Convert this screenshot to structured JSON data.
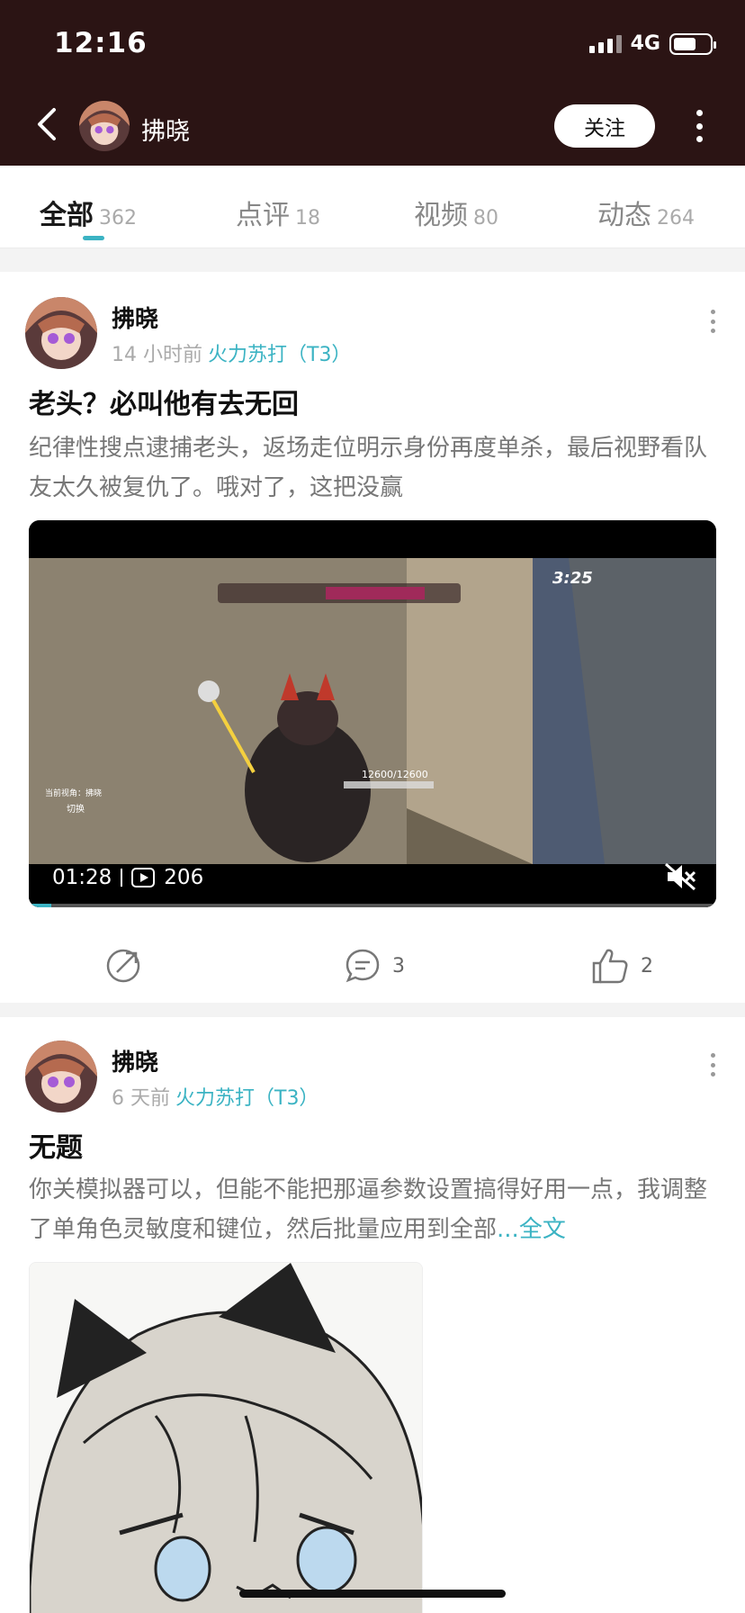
{
  "status_bar": {
    "time": "12:16",
    "network": "4G",
    "battery_level": 0.64
  },
  "nav": {
    "username": "拂晓",
    "follow_label": "关注"
  },
  "tabs": [
    {
      "label": "全部",
      "count": "362"
    },
    {
      "label": "点评",
      "count": "18"
    },
    {
      "label": "视频",
      "count": "80"
    },
    {
      "label": "动态",
      "count": "264"
    }
  ],
  "posts": [
    {
      "author": "拂晓",
      "time": "14 小时前",
      "game": "火力苏打（T3）",
      "title": "老头？必叫他有去无回",
      "body": "纪律性搜点逮捕老头，返场走位明示身份再度单杀，最后视野看队友太久被复仇了。哦对了，这把没赢",
      "video": {
        "duration": "01:28",
        "plays": "206",
        "hud_timer": "3:25",
        "hud_hp": "12600/12600",
        "hud_view_label": "当前视角：拂晓",
        "hud_switch": "切换",
        "played_fraction": 0.033
      },
      "comments": "3",
      "likes": "2"
    },
    {
      "author": "拂晓",
      "time": "6 天前",
      "game": "火力苏打（T3）",
      "title": "无题",
      "body": "你关模拟器可以，但能不能把那逼参数设置搞得好用一点，我调整了单角色灵敏度和键位，然后批量应用到全部",
      "ellipsis": "...",
      "read_more": "全文"
    }
  ],
  "colors": {
    "header_bg": "#2b1414",
    "accent": "#3bb3c3"
  }
}
